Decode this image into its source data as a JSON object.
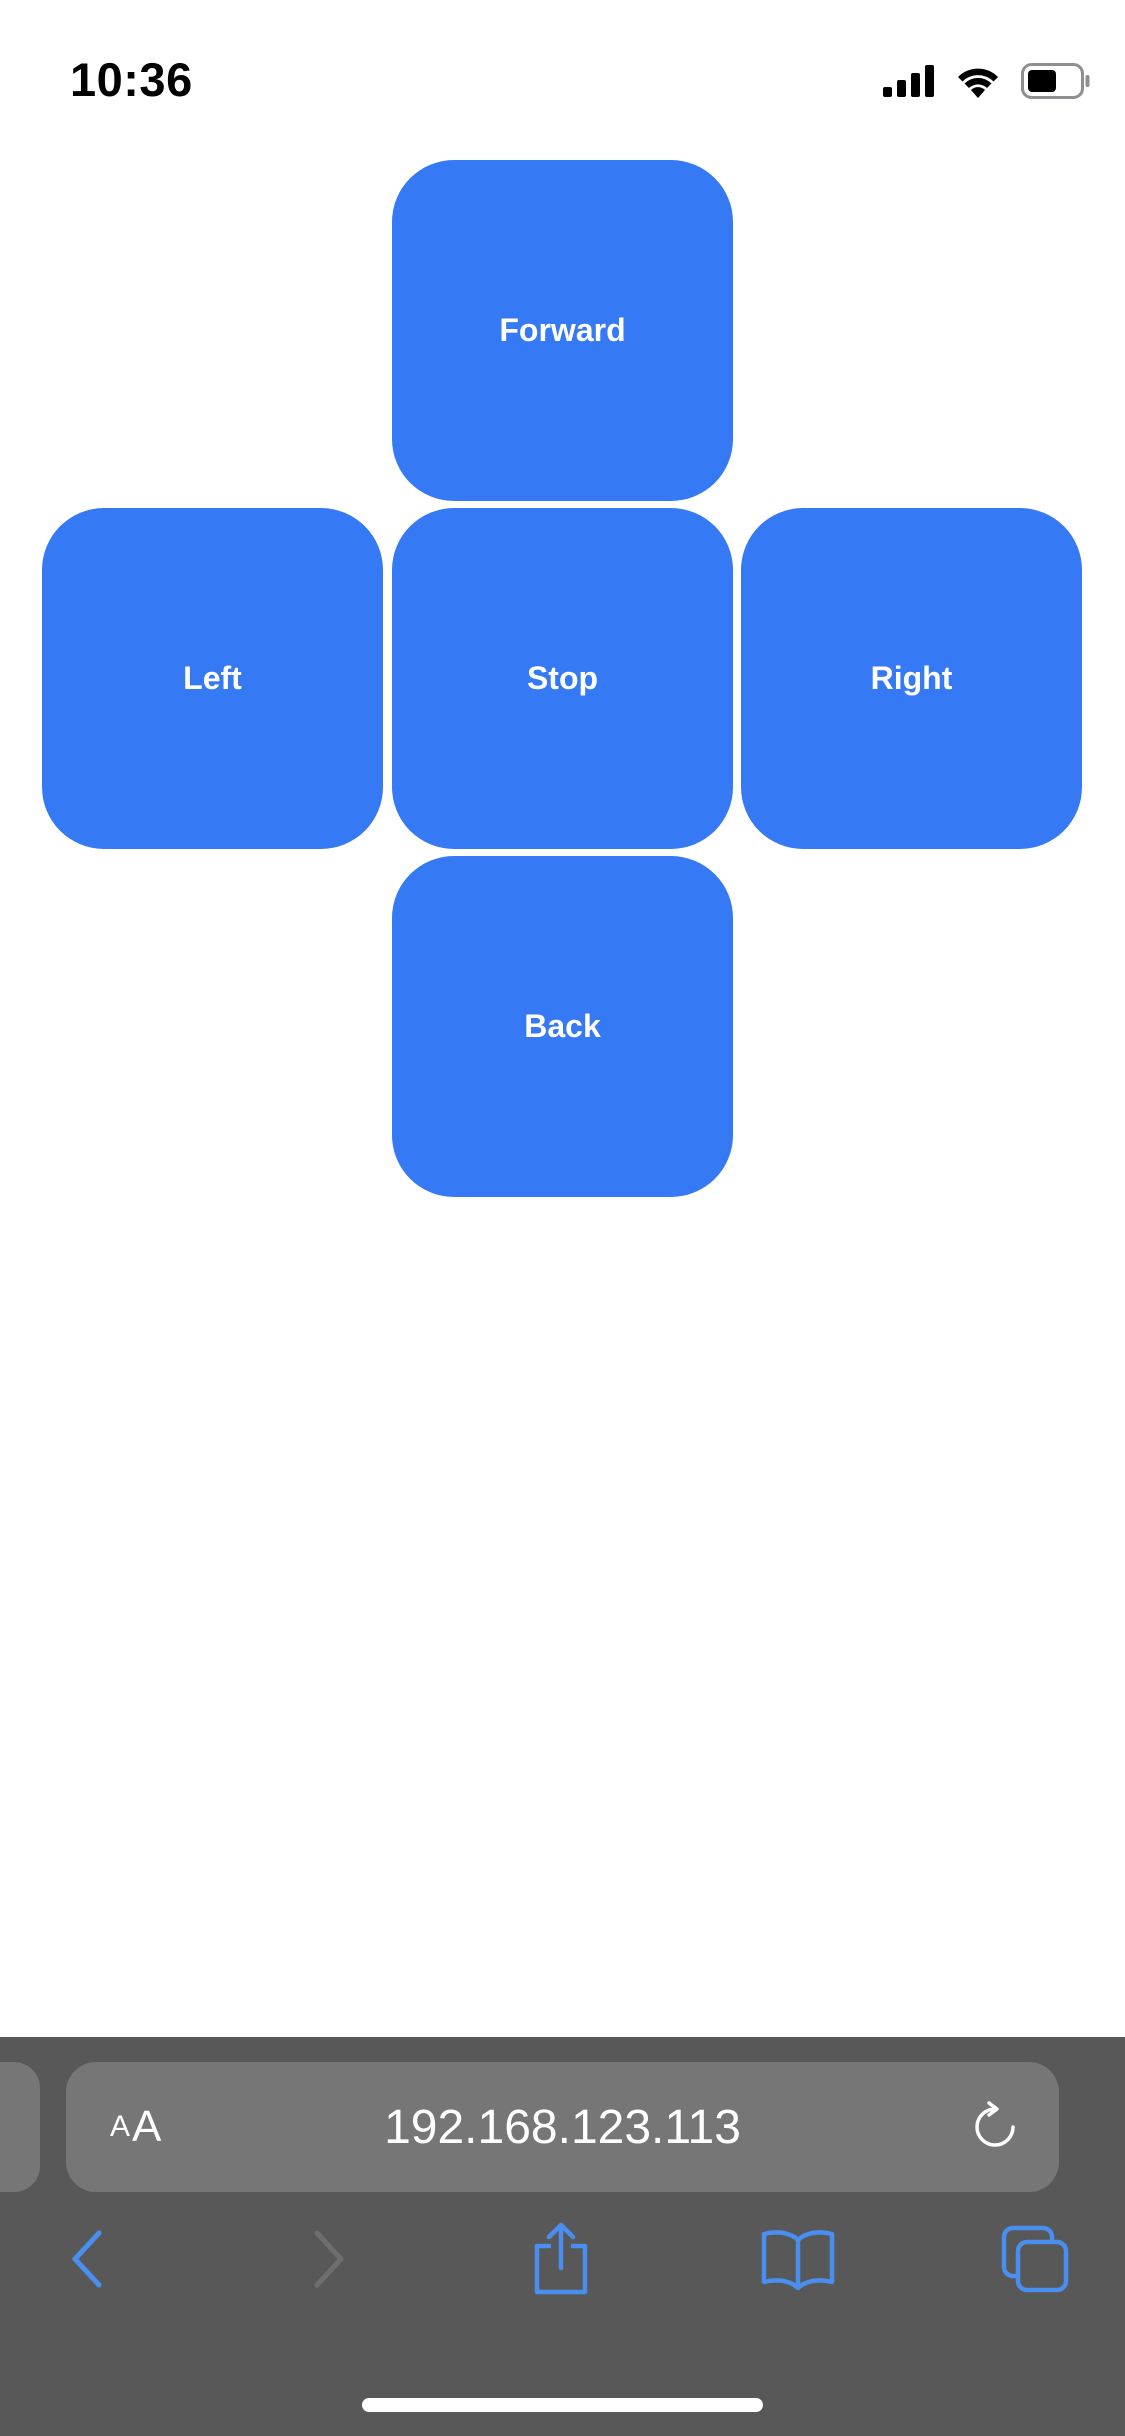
{
  "status_bar": {
    "time": "10:36",
    "icons": [
      "cellular-signal-icon",
      "wifi-icon",
      "battery-icon"
    ]
  },
  "controls": {
    "forward_label": "Forward",
    "left_label": "Left",
    "stop_label": "Stop",
    "right_label": "Right",
    "back_label": "Back",
    "button_color": "#3579f5",
    "label_color": "#ffffff"
  },
  "browser": {
    "text_size_small": "A",
    "text_size_large": "A",
    "url": "192.168.123.113",
    "toolbar_icons": [
      "back-arrow-icon",
      "forward-arrow-icon",
      "share-icon",
      "bookmarks-icon",
      "tabs-icon"
    ],
    "accent_color": "#4a8ff0",
    "toolbar_color": "#585858"
  }
}
